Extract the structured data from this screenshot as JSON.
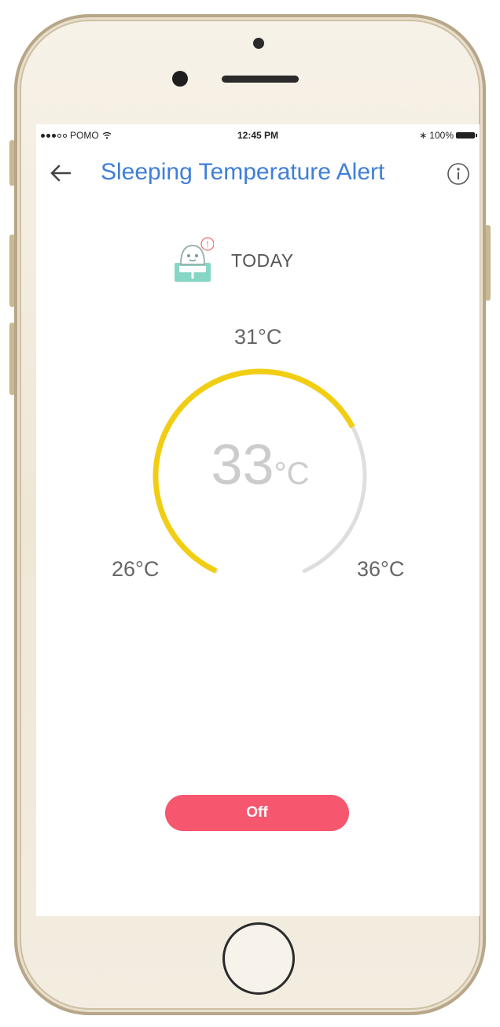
{
  "status_bar": {
    "carrier": "POMO",
    "time": "12:45 PM",
    "battery": "100%",
    "bluetooth_symbol": "∗"
  },
  "header": {
    "title": "Sleeping Temperature Alert",
    "back_icon": "arrow-left-icon",
    "info_icon": "info-circle-icon"
  },
  "today": {
    "label": "TODAY",
    "icon": "baby-alert-icon",
    "alert_badge": "!"
  },
  "gauge": {
    "current": "33",
    "unit": "°C",
    "min_label": "26°C",
    "threshold_label": "31°C",
    "max_label": "36°C",
    "min_value": 26,
    "threshold_value": 31,
    "max_value": 36,
    "current_value": 33,
    "colors": {
      "active": "#f1ce14",
      "track": "#dedede",
      "value_text": "#cccccc"
    }
  },
  "actions": {
    "off_label": "Off",
    "off_color": "#f6566e"
  },
  "colors": {
    "title": "#3f7fd8"
  }
}
